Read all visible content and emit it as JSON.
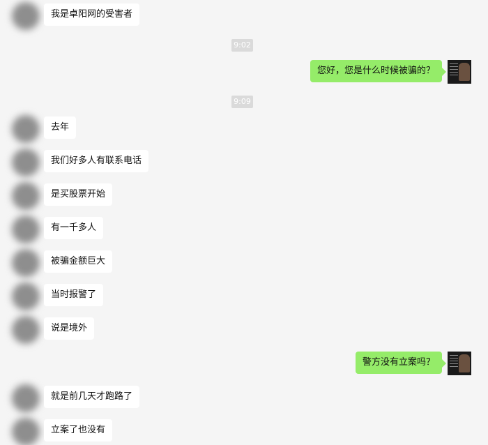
{
  "messages": [
    {
      "side": "left",
      "text": "我是卓阳网的受害者"
    },
    {
      "type": "time",
      "text": "9:02"
    },
    {
      "side": "right",
      "text": "您好，您是什么时候被骗的？"
    },
    {
      "type": "time",
      "text": "9:09"
    },
    {
      "side": "left",
      "text": "去年"
    },
    {
      "side": "left",
      "text": "我们好多人有联系电话"
    },
    {
      "side": "left",
      "text": "是买股票开始"
    },
    {
      "side": "left",
      "text": "有一千多人"
    },
    {
      "side": "left",
      "text": "被骗金额巨大"
    },
    {
      "side": "left",
      "text": "当时报警了"
    },
    {
      "side": "left",
      "text": "说是境外"
    },
    {
      "side": "right",
      "text": "警方没有立案吗？"
    },
    {
      "side": "left",
      "text": "就是前几天才跑路了"
    },
    {
      "side": "left",
      "text": "立案了也没有"
    }
  ],
  "colors": {
    "background": "#f5f5f5",
    "sent_bubble": "#95ec69",
    "received_bubble": "#ffffff",
    "time_badge": "#dadada"
  }
}
